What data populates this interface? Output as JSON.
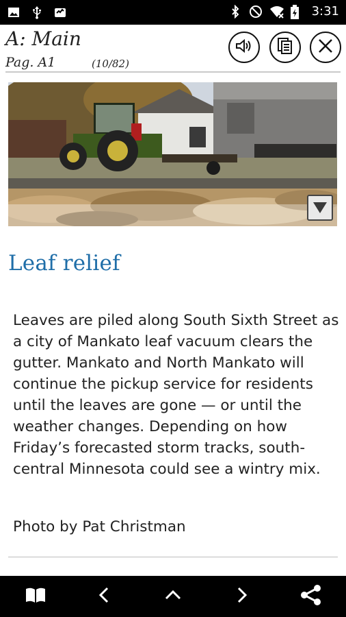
{
  "status_bar": {
    "time": "3:31",
    "left_icons": [
      "image-icon",
      "usb-icon",
      "inbox-icon"
    ],
    "right_icons": [
      "bluetooth-icon",
      "do-not-disturb-icon",
      "wifi-icon",
      "battery-icon"
    ]
  },
  "header": {
    "section": "A: Main",
    "page": "Pag. A1",
    "count": "(10/82)",
    "buttons": [
      "speaker-icon",
      "copy-pages-icon",
      "close-icon"
    ]
  },
  "article": {
    "headline": "Leaf relief",
    "caption": "Leaves are piled along South Sixth Street as a city of Mankato leaf vacuum clears the gutter. Mankato and North Mankato will continue the pickup service for residents until the leaves are gone — or until the weather changes. Depending on how Friday’s forecasted storm tracks, south-central Minnesota could see a wintry mix.",
    "credit": "Photo by Pat Christman"
  },
  "nav_bar": {
    "buttons": [
      "book-icon",
      "back-arrow-icon",
      "up-arrow-icon",
      "forward-arrow-icon",
      "share-icon"
    ]
  },
  "colors": {
    "headline": "#1f6ea8",
    "status_bar": "#000000",
    "nav_bar": "#000000"
  }
}
